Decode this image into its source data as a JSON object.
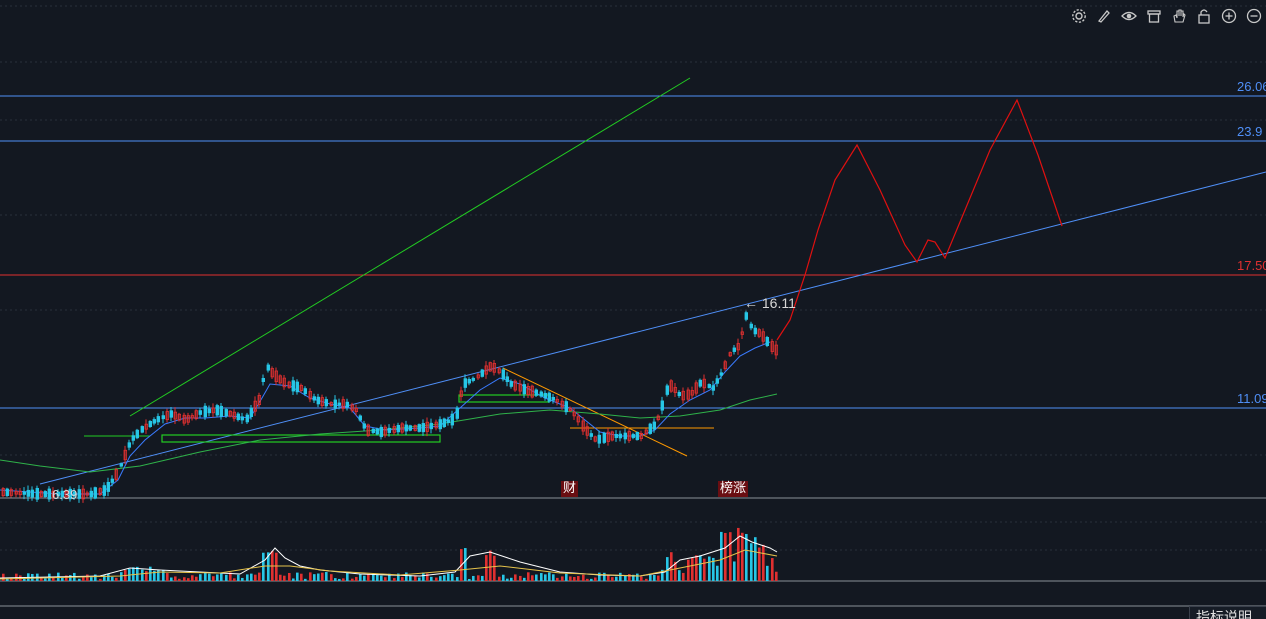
{
  "toolbar": {
    "tools": [
      "settings-icon",
      "pen-icon",
      "eye-icon",
      "trash-icon",
      "hand-icon",
      "lock-icon",
      "zoom-in-icon",
      "zoom-out-icon"
    ]
  },
  "price_levels": [
    {
      "label": "26.06",
      "color": "#4f8ff7"
    },
    {
      "label": "23.9",
      "color": "#4f8ff7"
    },
    {
      "label": "17.50",
      "color": "#e03030"
    },
    {
      "label": "11.09",
      "color": "#4f8ff7"
    }
  ],
  "annotations": {
    "peak_label": "← 16.11",
    "low_label": "6.39",
    "events": [
      "财",
      "榜涨"
    ]
  },
  "indicator_button": "指标说明",
  "colors": {
    "background": "#131821",
    "up": "#e03030",
    "down": "#27c6e6",
    "ma_short": "#3a7bff",
    "ma_long": "#2fb24a",
    "trend_green": "#22cc22",
    "trend_orange": "#ff9900",
    "projection": "#e01010"
  },
  "chart_data": {
    "type": "candlestick",
    "price_levels": [
      26.06,
      23.9,
      17.5,
      11.09
    ],
    "peak_price": 16.11,
    "low_price": 6.39,
    "notes": "daily candlestick chart with volume sub-panel and hand-drawn projection"
  }
}
